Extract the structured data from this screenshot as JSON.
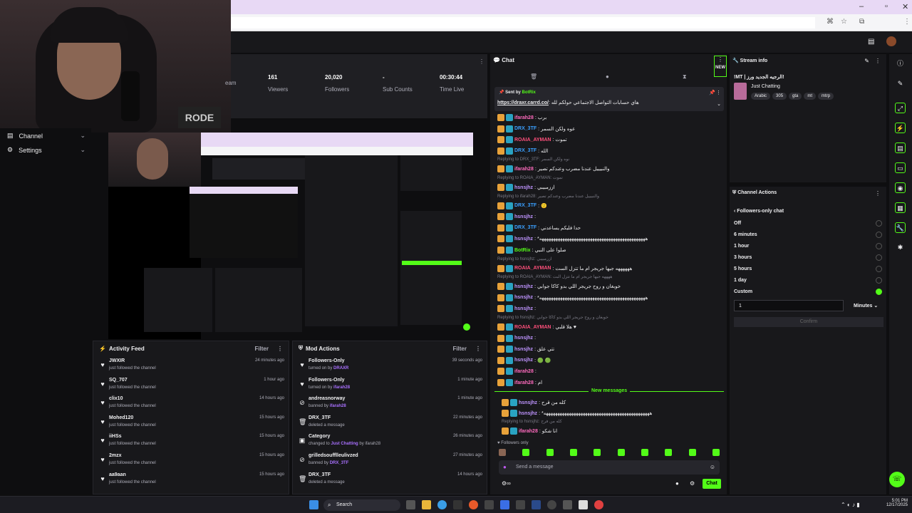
{
  "stats": [
    {
      "value": "",
      "label": "eam"
    },
    {
      "value": "161",
      "label": "Viewers"
    },
    {
      "value": "20,020",
      "label": "Followers"
    },
    {
      "value": "-",
      "label": "Sub Counts"
    },
    {
      "value": "00:30:44",
      "label": "Time Live"
    }
  ],
  "nav": [
    {
      "label": "Channel"
    },
    {
      "label": "Settings"
    }
  ],
  "activity": {
    "title": "Activity Feed",
    "filter": "Filter",
    "items": [
      {
        "name": "JWXIR",
        "sub": "just followed the channel",
        "time": "24 minutes ago"
      },
      {
        "name": "SQ_707",
        "sub": "just followed the channel",
        "time": "1 hour ago"
      },
      {
        "name": "clix10",
        "sub": "just followed the channel",
        "time": "14 hours ago"
      },
      {
        "name": "Mohed120",
        "sub": "just followed the channel",
        "time": "15 hours ago"
      },
      {
        "name": "iiHSs",
        "sub": "just followed the channel",
        "time": "15 hours ago"
      },
      {
        "name": "2mzx",
        "sub": "just followed the channel",
        "time": "15 hours ago"
      },
      {
        "name": "aa9aan",
        "sub": "just followed the channel",
        "time": "15 hours ago"
      }
    ]
  },
  "modactions": {
    "title": "Mod Actions",
    "filter": "Filter",
    "items": [
      {
        "icon": "♥",
        "name": "Followers-Only",
        "pre": "turned on by",
        "by": "DRAXR",
        "post": "",
        "time": "39 seconds ago"
      },
      {
        "icon": "♥",
        "name": "Followers-Only",
        "pre": "turned on by",
        "by": "ifarah28",
        "post": "",
        "time": "1 minute ago"
      },
      {
        "icon": "⊘",
        "name": "andreasnorway",
        "pre": "banned by",
        "by": "ifarah28",
        "post": "",
        "time": "1 minute ago"
      },
      {
        "icon": "🗑",
        "name": "DRX_3TF",
        "pre": "deleted a message",
        "by": "",
        "post": "",
        "time": "22 minutes ago"
      },
      {
        "icon": "▣",
        "name": "Category",
        "pre": "changed to",
        "by": "Just Chatting",
        "post": "by ifarah28",
        "time": "26 minutes ago"
      },
      {
        "icon": "⊘",
        "name": "grilledsoufflleulivzed",
        "pre": "banned by",
        "by": "DRX_3TF",
        "post": "",
        "time": "27 minutes ago"
      },
      {
        "icon": "🗑",
        "name": "DRX_3TF",
        "pre": "deleted a message",
        "by": "",
        "post": "",
        "time": "14 hours ago"
      }
    ]
  },
  "chat": {
    "title": "Chat",
    "new_label": "NEW",
    "pinned": {
      "sent_by": "Sent by",
      "bot": "BotRix",
      "link": "https://draxr.carrd.co/",
      "text": ": هاي حسابات التواصل الاجتماعي حولكم لله"
    },
    "messages": [
      {
        "reply": "",
        "user": "ifarah28",
        "color": "#ff6bbf",
        "text": ": برب"
      },
      {
        "reply": "",
        "user": "DRX_3TF",
        "color": "#3aa0ff",
        "text": ": عوه ولكن السمر"
      },
      {
        "reply": "",
        "user": "ROAIA_AYMAN",
        "color": "#ff4f7b",
        "text": ": تموت"
      },
      {
        "reply": "",
        "user": "DRX_3TF",
        "color": "#3aa0ff",
        "text": ": الله"
      },
      {
        "reply": "Replying to DRX_3TF: نوه ولكن السمر",
        "user": "ifarah28",
        "color": "#ff6bbf",
        "text": ": والنبيييل عندنا مضرب وعندكم تصير"
      },
      {
        "reply": "Replying to ROAIA_AYMAN: تموت",
        "user": "hsnsjhz",
        "color": "#bf94ff",
        "text": ": اززمبيبي"
      },
      {
        "reply": "Replying to ifarah28: والنبيييل عندنا مضرب وعندكم تصير",
        "user": "DRX_3TF",
        "color": "#3aa0ff",
        "text": ": 🙂"
      },
      {
        "reply": "",
        "user": "hsnsjhz",
        "color": "#bf94ff",
        "text": ": "
      },
      {
        "reply": "",
        "user": "DRX_3TF",
        "color": "#3aa0ff",
        "text": ": حدا فليكم يساعدني"
      },
      {
        "reply": "",
        "user": "hsnsjhz",
        "color": "#bf94ff",
        "text": ": *ههههههههههههههههههههههههههههههههههههههههههههههه"
      },
      {
        "reply": "",
        "user": "BotRix",
        "color": "#53fc18",
        "text": ": صلوا على النبي"
      },
      {
        "reply": "Replying to hsnsjhz: ازرمبيبي",
        "user": "ROAIA_AYMAN",
        "color": "#ff4f7b",
        "text": ": ههههههه جيها جريجر ام ما تتزل الست"
      },
      {
        "reply": "Replying to ROAIA_AYMAN: ههههه جيها جريجر ام ما تتزل البت",
        "user": "hsnsjhz",
        "color": "#bf94ff",
        "text": ": خوبغان و روح جريجر اللي بدو كاكا جوابي"
      },
      {
        "reply": "",
        "user": "hsnsjhz",
        "color": "#bf94ff",
        "text": ": *ههههههههههههههههههههههههههههههههههههههههههههههه"
      },
      {
        "reply": "",
        "user": "hsnsjhz",
        "color": "#bf94ff",
        "text": ": "
      },
      {
        "reply": "Replying to hsnsjhz: خوبغان و روح جريجر اللي بدو كاكا جوابي",
        "user": "ROAIA_AYMAN",
        "color": "#ff4f7b",
        "text": ": هلا قلبي ♥"
      },
      {
        "reply": "",
        "user": "hsnsjhz",
        "color": "#bf94ff",
        "text": ": "
      },
      {
        "reply": "",
        "user": "hsnsjhz",
        "color": "#bf94ff",
        "text": ": تتي علق"
      },
      {
        "reply": "",
        "user": "hsnsjhz",
        "color": "#bf94ff",
        "text": ": 🟢 🟢"
      },
      {
        "reply": "",
        "user": "ifarah28",
        "color": "#ff6bbf",
        "text": ": "
      },
      {
        "reply": "",
        "user": "ifarah28",
        "color": "#ff6bbf",
        "text": ": ام"
      }
    ],
    "new_messages": "New messages",
    "new": [
      {
        "reply": "",
        "user": "hsnsjhz",
        "color": "#bf94ff",
        "text": ": كله من قرح"
      },
      {
        "reply": "",
        "user": "hsnsjhz",
        "color": "#bf94ff",
        "text": ": *ههههههههههههههههههههههههههههههههههههههههههههههه"
      },
      {
        "reply": "Replying to hsnsjhz: كله من فرح",
        "user": "ifarah28",
        "color": "#ff6bbf",
        "text": ": انا شكو"
      }
    ],
    "followers_only": "Followers only",
    "placeholder": "Send a message",
    "send": "Chat"
  },
  "streaminfo": {
    "title": "Stream info",
    "stream_title": "!MT | الرجيه الجديد ورز!",
    "category": "Just Chatting",
    "tags": [
      "Arabic",
      "305",
      "gta",
      "mt",
      "mtrp"
    ]
  },
  "chanact": {
    "title": "Channel Actions",
    "back": "Followers-only chat",
    "options": [
      {
        "label": "Off"
      },
      {
        "label": "6 minutes"
      },
      {
        "label": "1 hour"
      },
      {
        "label": "3 hours"
      },
      {
        "label": "5 hours"
      },
      {
        "label": "1 day"
      },
      {
        "label": "Custom",
        "selected": true
      }
    ],
    "custom_value": "1",
    "unit": "Minutes",
    "confirm": "Confirm"
  },
  "taskbar": {
    "search": "Search",
    "time": "5:01 PM",
    "date": "12/17/2025"
  },
  "colors": {
    "accent": "#53fc18",
    "bg": "#0e0e10",
    "panel": "#18181b"
  }
}
